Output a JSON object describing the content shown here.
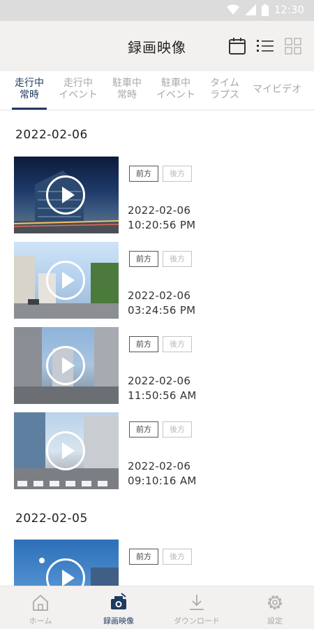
{
  "status": {
    "time": "12:30"
  },
  "header": {
    "title": "録画映像"
  },
  "tabs": [
    {
      "label": "走行中\n常時",
      "active": true
    },
    {
      "label": "走行中\nイベント",
      "active": false
    },
    {
      "label": "駐車中\n常時",
      "active": false
    },
    {
      "label": "駐車中\nイベント",
      "active": false
    },
    {
      "label": "タイム\nラプス",
      "active": false
    },
    {
      "label": "マイビデオ",
      "active": false
    }
  ],
  "groups": [
    {
      "date": "2022-02-06",
      "recordings": [
        {
          "front": "前方",
          "rear": "後方",
          "date": "2022-02-06",
          "time": "10:20:56 PM"
        },
        {
          "front": "前方",
          "rear": "後方",
          "date": "2022-02-06",
          "time": "03:24:56 PM"
        },
        {
          "front": "前方",
          "rear": "後方",
          "date": "2022-02-06",
          "time": "11:50:56 AM"
        },
        {
          "front": "前方",
          "rear": "後方",
          "date": "2022-02-06",
          "time": "09:10:16 AM"
        }
      ]
    },
    {
      "date": "2022-02-05",
      "recordings": [
        {
          "front": "前方",
          "rear": "後方"
        }
      ]
    }
  ],
  "nav": [
    {
      "label": "ホーム",
      "icon": "home-icon",
      "active": false
    },
    {
      "label": "録画映像",
      "icon": "dashcam-icon",
      "active": true
    },
    {
      "label": "ダウンロード",
      "icon": "download-icon",
      "active": false
    },
    {
      "label": "設定",
      "icon": "settings-icon",
      "active": false
    }
  ],
  "colors": {
    "accent": "#1f3a5f",
    "inactive": "#a8a8a8",
    "appbar": "#f3f1f0"
  }
}
